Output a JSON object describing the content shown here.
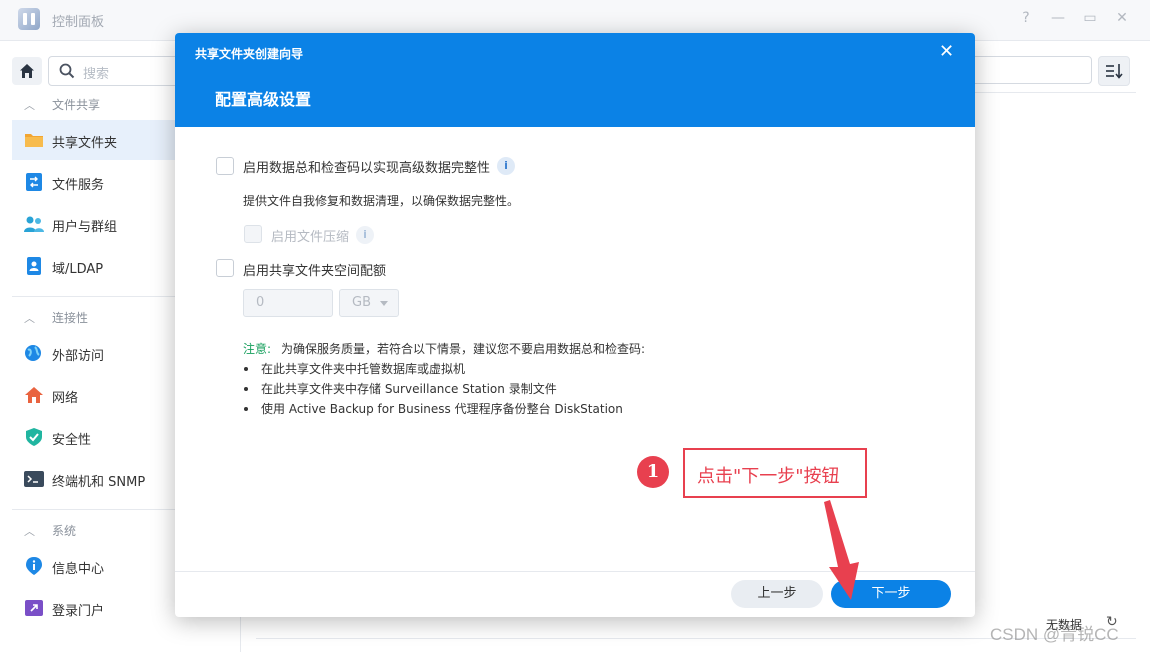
{
  "window": {
    "title": "控制面板",
    "help": "?",
    "minimize": "—",
    "maximize": "▭",
    "close": "✕"
  },
  "sidebar": {
    "search_placeholder": "搜索",
    "sections": [
      {
        "label": "文件共享",
        "items": [
          {
            "label": "共享文件夹",
            "icon": "folder-icon",
            "active": true
          },
          {
            "label": "文件服务",
            "icon": "file-services-icon"
          },
          {
            "label": "用户与群组",
            "icon": "users-icon"
          },
          {
            "label": "域/LDAP",
            "icon": "domain-icon"
          }
        ]
      },
      {
        "label": "连接性",
        "items": [
          {
            "label": "外部访问",
            "icon": "globe-icon"
          },
          {
            "label": "网络",
            "icon": "network-home-icon"
          },
          {
            "label": "安全性",
            "icon": "shield-icon"
          },
          {
            "label": "终端机和 SNMP",
            "icon": "terminal-icon"
          }
        ]
      },
      {
        "label": "系统",
        "items": [
          {
            "label": "信息中心",
            "icon": "info-icon"
          },
          {
            "label": "登录门户",
            "icon": "portal-icon"
          }
        ]
      }
    ]
  },
  "main": {
    "no_data": "无数据",
    "watermark": "CSDN @青锐CC"
  },
  "modal": {
    "wizard_title": "共享文件夹创建向导",
    "close": "✕",
    "step_title": "配置高级设置",
    "checksum_label": "启用数据总和检查码以实现高级数据完整性",
    "checksum_desc": "提供文件自我修复和数据清理，以确保数据完整性。",
    "compression_label": "启用文件压缩",
    "quota_label": "启用共享文件夹空间配额",
    "quota_value": "0",
    "quota_unit": "GB",
    "note_label": "注意:",
    "note_text": "为确保服务质量，若符合以下情景，建议您不要启用数据总和检查码:",
    "bullets": [
      "在此共享文件夹中托管数据库或虚拟机",
      "在此共享文件夹中存储 Surveillance Station 录制文件",
      "使用 Active Backup for Business 代理程序备份整台 DiskStation"
    ],
    "prev_button": "上一步",
    "next_button": "下一步"
  },
  "annotation": {
    "number": "1",
    "text": "点击\"下一步\"按钮",
    "color": "#e8404f"
  },
  "colors": {
    "accent": "#0b82e6",
    "sidebar_active": "#e7f0fb",
    "note_green": "#18a05e"
  }
}
